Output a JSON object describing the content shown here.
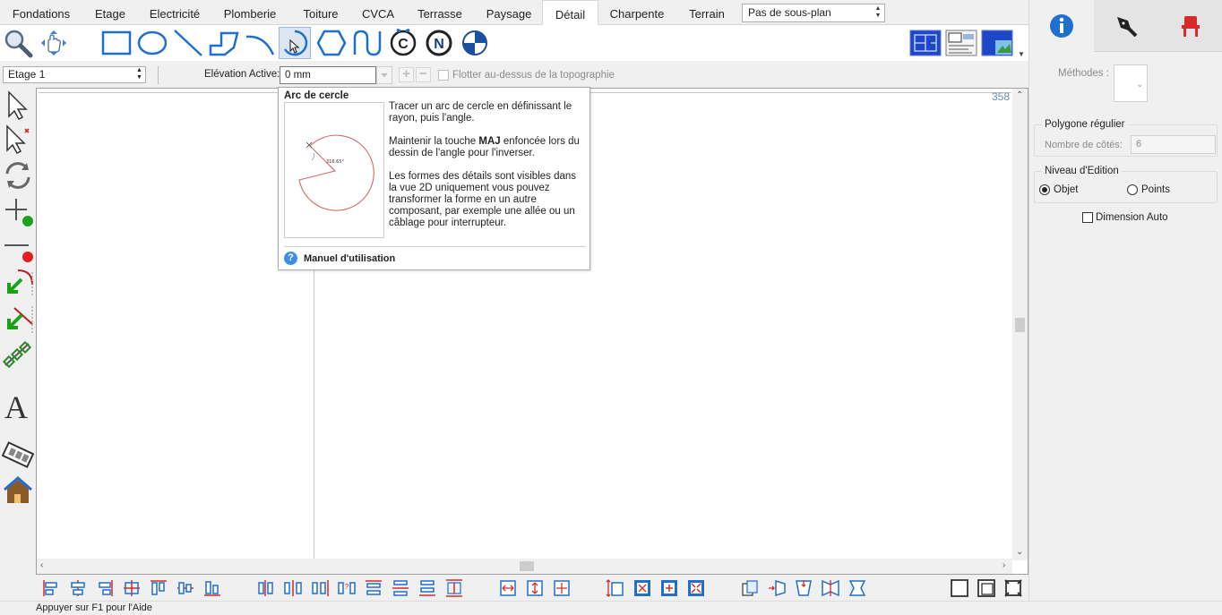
{
  "menu_tabs": [
    "Fondations",
    "Etage",
    "Electricité",
    "Plomberie",
    "Toiture",
    "CVCA",
    "Terrasse",
    "Paysage",
    "Détail",
    "Charpente",
    "Terrain"
  ],
  "active_tab": "Détail",
  "subplan_select": "Pas de sous-plan",
  "toolbar_tools": [
    "magnifier-icon",
    "pan-hand-icon",
    "rectangle-icon",
    "circle-icon",
    "line-icon",
    "polyline-icon",
    "arc-icon",
    "arc-circle-icon",
    "hexagon-icon",
    "curve-icon",
    "copyright-icon",
    "north-icon",
    "target-icon"
  ],
  "pressed_tool": "arc-circle-icon",
  "view_tools": [
    "floor-plan-view-icon",
    "layout-view-icon",
    "3d-view-icon"
  ],
  "options": {
    "floor_select": "Etage 1",
    "elevation_label": "Elévation Active:",
    "elevation_value": "0 mm",
    "float_label": "Flotter au-dessus de la topographie"
  },
  "canvas": {
    "ruler_number": "358"
  },
  "tooltip": {
    "title": "Arc de cercle",
    "image_label": "316.65°",
    "paragraph1": "Tracer un arc de cercle en définissant le rayon, puis l'angle.",
    "paragraph2_before": "Maintenir la touche ",
    "paragraph2_bold": "MAJ",
    "paragraph2_after": " enfoncée lors du dessin de l'angle pour l'inverser.",
    "paragraph3": "Les formes des détails sont visibles dans la vue 2D uniquement vous pouvez transformer la forme en un autre composant, par exemple une allée ou un câblage pour interrupteur.",
    "help_icon_text": "?",
    "help_link": "Manuel d'utilisation"
  },
  "right_panel": {
    "tabs": [
      "info-icon",
      "pen-icon",
      "chair-icon"
    ],
    "methods_label": "Méthodes :",
    "polygon_group": "Polygone régulier",
    "sides_label": "Nombre de côtés:",
    "sides_value": "6",
    "edit_group": "Niveau d'Edition",
    "radio_object": "Objet",
    "radio_points": "Points",
    "radio_selected": "Objet",
    "auto_dimension": "Dimension Auto"
  },
  "status_text": "Appuyer sur F1 pour l'Aide",
  "colors": {
    "accent_blue": "#1f6fd0",
    "red": "#d62b2b",
    "green": "#1aa31a",
    "canvas_bg": "#ffffff"
  }
}
